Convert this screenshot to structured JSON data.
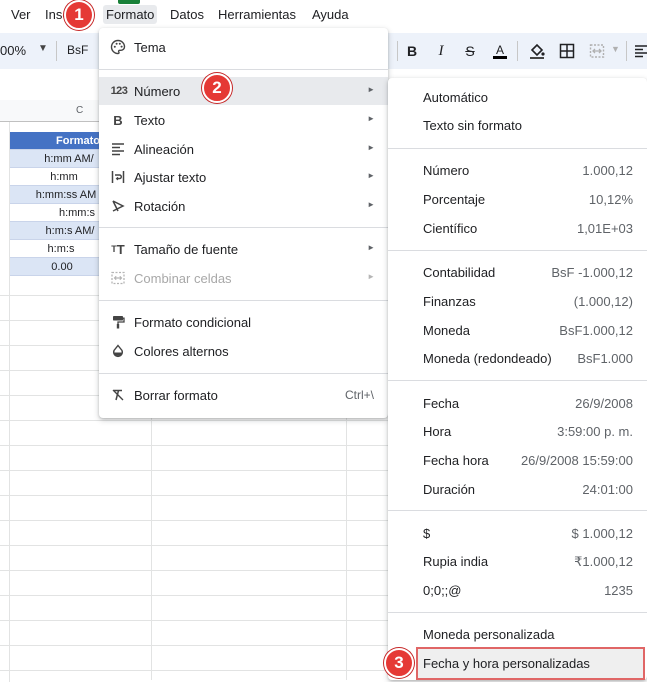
{
  "menubar": {
    "items": [
      "Ver",
      "Inse",
      "Formato",
      "Datos",
      "Herramientas",
      "Ayuda"
    ]
  },
  "toolbar": {
    "zoom": "00%",
    "currency": "BsF"
  },
  "sheet": {
    "column_label": "C",
    "cells": [
      "Formato",
      "h:mm AM/",
      "h:mm",
      "h:mm:ss AM",
      "h:mm:s",
      "h:m:s AM/",
      "h:m:s",
      "0.00"
    ]
  },
  "format_menu": {
    "items": [
      {
        "label": "Tema",
        "icon": "palette-icon"
      },
      {
        "label": "Número",
        "icon": "number-format-icon",
        "badge": "2"
      },
      {
        "label": "Texto",
        "icon": "bold-icon"
      },
      {
        "label": "Alineación",
        "icon": "align-icon"
      },
      {
        "label": "Ajustar texto",
        "icon": "wrap-icon"
      },
      {
        "label": "Rotación",
        "icon": "rotation-icon"
      },
      {
        "label": "Tamaño de fuente",
        "icon": "font-size-icon"
      },
      {
        "label": "Combinar celdas",
        "icon": "merge-icon"
      },
      {
        "label": "Formato condicional",
        "icon": "paint-roller-icon"
      },
      {
        "label": "Colores alternos",
        "icon": "drop-icon"
      },
      {
        "label": "Borrar formato",
        "icon": "clear-format-icon",
        "shortcut": "Ctrl+\\"
      }
    ]
  },
  "number_menu": {
    "items": [
      {
        "label": "Automático",
        "value": ""
      },
      {
        "label": "Texto sin formato",
        "value": ""
      },
      {
        "label": "Número",
        "value": "1.000,12"
      },
      {
        "label": "Porcentaje",
        "value": "10,12%"
      },
      {
        "label": "Científico",
        "value": "1,01E+03"
      },
      {
        "label": "Contabilidad",
        "value": "BsF -1.000,12"
      },
      {
        "label": "Finanzas",
        "value": "(1.000,12)"
      },
      {
        "label": "Moneda",
        "value": "BsF1.000,12"
      },
      {
        "label": "Moneda (redondeado)",
        "value": "BsF1.000"
      },
      {
        "label": "Fecha",
        "value": "26/9/2008"
      },
      {
        "label": "Hora",
        "value": "3:59:00 p. m."
      },
      {
        "label": "Fecha hora",
        "value": "26/9/2008 15:59:00"
      },
      {
        "label": "Duración",
        "value": "24:01:00"
      },
      {
        "label": "$",
        "value": "$ 1.000,12"
      },
      {
        "label": "Rupia india",
        "value": "₹1.000,12"
      },
      {
        "label": "0;0;;@",
        "value": "1235"
      },
      {
        "label": "Moneda personalizada",
        "value": ""
      },
      {
        "label": "Fecha y hora personalizadas",
        "value": ""
      }
    ]
  },
  "badges": [
    "1",
    "2",
    "3"
  ],
  "colors": {
    "badge": "#e53935",
    "highlight_box": "#e06666",
    "header_fill": "#4472c4",
    "alt_fill": "#dbe5f5",
    "toolbar_bg": "#edf2fa"
  }
}
